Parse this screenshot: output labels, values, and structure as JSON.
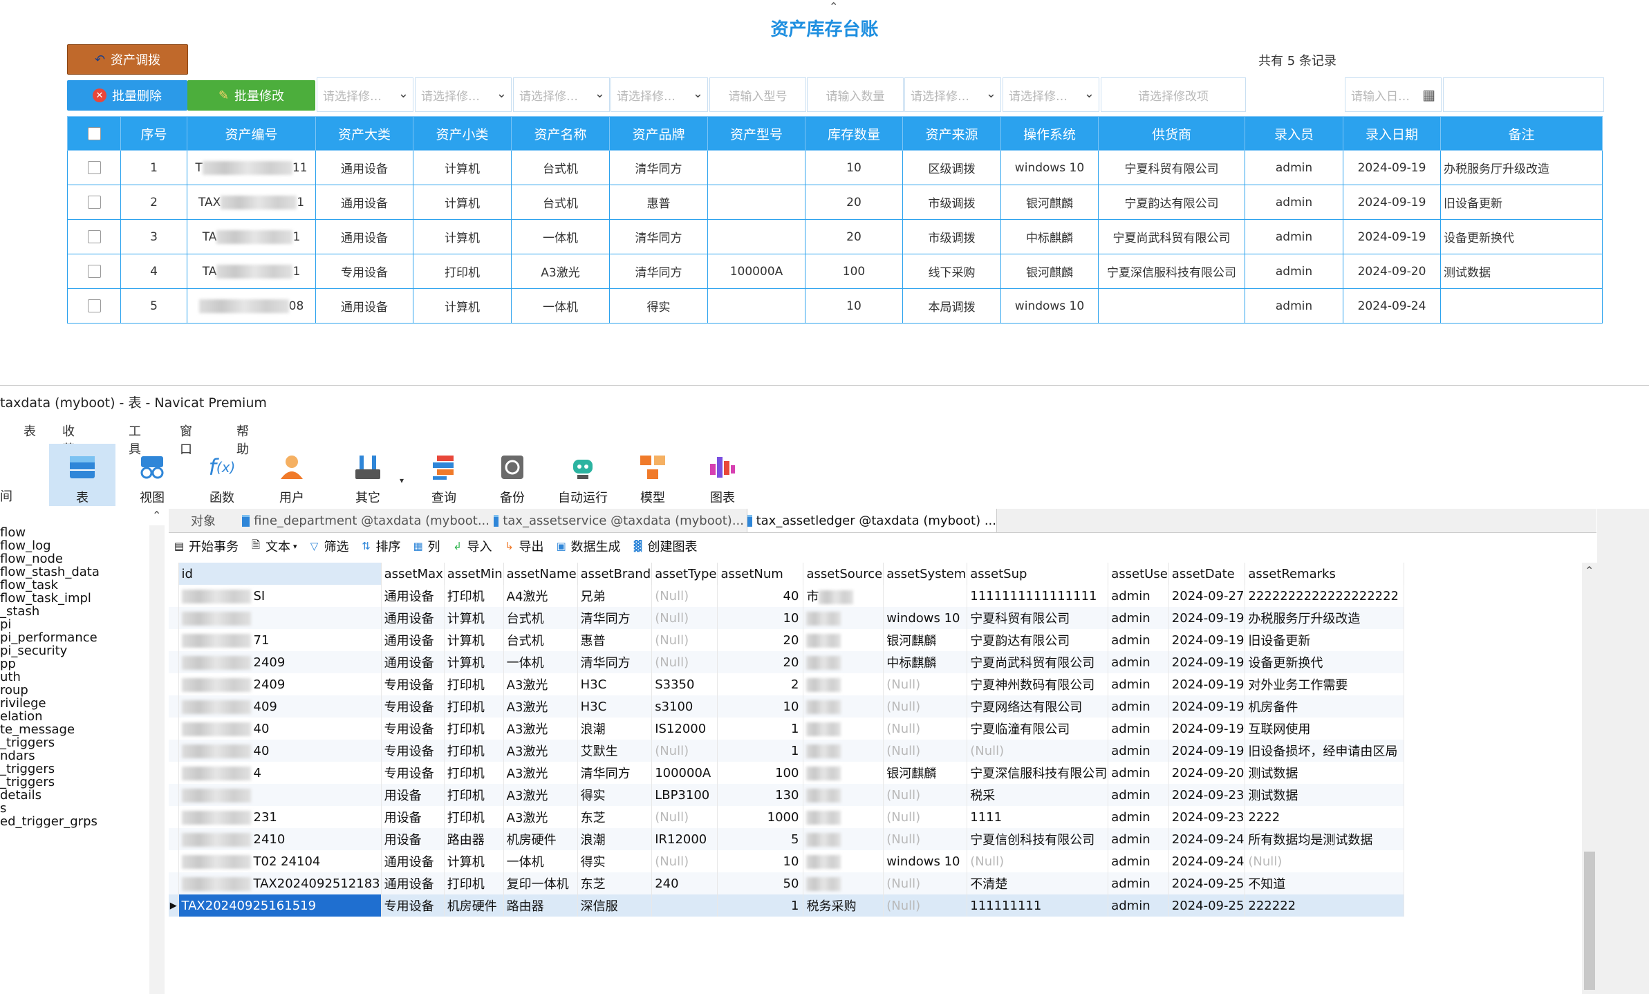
{
  "web": {
    "title": "资产库存台账",
    "collapse_icon": "double-chevron-up",
    "adjust_button": "资产调拨",
    "batch_delete_button": "批量删除",
    "batch_edit_button": "批量修改",
    "record_count": "共有 5 条记录",
    "filters": {
      "select_placeholder": "请选择修…",
      "model_placeholder": "请输入型号",
      "qty_placeholder": "请输入数量",
      "edit_item_placeholder": "请选择修改项",
      "date_placeholder": "请输入日…"
    },
    "columns": [
      "序号",
      "资产编号",
      "资产大类",
      "资产小类",
      "资产名称",
      "资产品牌",
      "资产型号",
      "库存数量",
      "资产来源",
      "操作系统",
      "供货商",
      "录入员",
      "录入日期",
      "备注"
    ],
    "rows": [
      {
        "no": "1",
        "code_prefix": "T",
        "code_suffix": "11",
        "major": "通用设备",
        "minor": "计算机",
        "name": "台式机",
        "brand": "清华同方",
        "model": "",
        "qty": "10",
        "source": "区级调拨",
        "os": "windows 10",
        "supplier": "宁夏科贸有限公司",
        "user": "admin",
        "date": "2024-09-19",
        "remark": "办税服务厅升级改造"
      },
      {
        "no": "2",
        "code_prefix": "TAX",
        "code_suffix": "1",
        "major": "通用设备",
        "minor": "计算机",
        "name": "台式机",
        "brand": "惠普",
        "model": "",
        "qty": "20",
        "source": "市级调拨",
        "os": "银河麒麟",
        "supplier": "宁夏韵达有限公司",
        "user": "admin",
        "date": "2024-09-19",
        "remark": "旧设备更新"
      },
      {
        "no": "3",
        "code_prefix": "TA",
        "code_suffix": "1",
        "major": "通用设备",
        "minor": "计算机",
        "name": "一体机",
        "brand": "清华同方",
        "model": "",
        "qty": "20",
        "source": "市级调拨",
        "os": "中标麒麟",
        "supplier": "宁夏尚武科贸有限公司",
        "user": "admin",
        "date": "2024-09-19",
        "remark": "设备更新换代"
      },
      {
        "no": "4",
        "code_prefix": "TA",
        "code_suffix": "1",
        "major": "专用设备",
        "minor": "打印机",
        "name": "A3激光",
        "brand": "清华同方",
        "model": "100000A",
        "qty": "100",
        "source": "线下采购",
        "os": "银河麒麟",
        "supplier": "宁夏深信服科技有限公司",
        "user": "admin",
        "date": "2024-09-20",
        "remark": "测试数据"
      },
      {
        "no": "5",
        "code_prefix": "",
        "code_suffix": "08",
        "major": "通用设备",
        "minor": "计算机",
        "name": "一体机",
        "brand": "得实",
        "model": "",
        "qty": "10",
        "source": "本局调拨",
        "os": "windows 10",
        "supplier": "",
        "user": "admin",
        "date": "2024-09-24",
        "remark": ""
      }
    ]
  },
  "navicat": {
    "window_title": "taxdata (myboot) - 表 - Navicat Premium",
    "menu": [
      "表",
      "收藏夹",
      "工具",
      "窗口",
      "帮助"
    ],
    "tools": [
      {
        "label": "表",
        "icon": "table-icon"
      },
      {
        "label": "视图",
        "icon": "view-icon"
      },
      {
        "label": "函数",
        "icon": "function-icon"
      },
      {
        "label": "用户",
        "icon": "user-icon"
      },
      {
        "label": "其它",
        "icon": "tools-icon"
      },
      {
        "label": "查询",
        "icon": "query-icon"
      },
      {
        "label": "备份",
        "icon": "backup-icon"
      },
      {
        "label": "自动运行",
        "icon": "robot-icon"
      },
      {
        "label": "模型",
        "icon": "model-icon"
      },
      {
        "label": "图表",
        "icon": "chart-icon"
      }
    ],
    "left_edge_label": "间",
    "sidebar": [
      "flow",
      "flow_log",
      "flow_node",
      "flow_stash_data",
      "flow_task",
      "flow_task_impl",
      "_stash",
      "pi",
      "pi_performance",
      "pi_security",
      "pp",
      "uth",
      "roup",
      "rivilege",
      "elation",
      "te_message",
      "_triggers",
      "ndars",
      "_triggers",
      "_triggers",
      "details",
      "s",
      "ed_trigger_grps"
    ],
    "tabs": [
      "对象",
      "fine_department @taxdata (myboot...",
      "tax_assetservice @taxdata (myboot)...",
      "tax_assetledger @taxdata (myboot) ..."
    ],
    "subtoolbar": [
      "开始事务",
      "文本",
      "筛选",
      "排序",
      "列",
      "导入",
      "导出",
      "数据生成",
      "创建图表"
    ],
    "grid_columns": [
      "id",
      "assetMax",
      "assetMin",
      "assetName",
      "assetBrand",
      "assetType",
      "assetNum",
      "assetSource",
      "assetSystem",
      "assetSup",
      "assetUse",
      "assetDate",
      "assetRemarks"
    ],
    "grid_rows": [
      {
        "id": "SI",
        "max": "通用设备",
        "min": "打印机",
        "name": "A4激光",
        "brand": "兄弟",
        "type": "(Null)",
        "num": "40",
        "src": "市",
        "sys": "",
        "sup": "1111111111111111",
        "use": "admin",
        "date": "2024-09-27",
        "remarks": "2222222222222222222"
      },
      {
        "id": "",
        "max": "通用设备",
        "min": "计算机",
        "name": "台式机",
        "brand": "清华同方",
        "type": "(Null)",
        "num": "10",
        "src": "",
        "sys": "windows 10",
        "sup": "宁夏科贸有限公司",
        "use": "admin",
        "date": "2024-09-19",
        "remarks": "办税服务厅升级改造"
      },
      {
        "id": "71",
        "max": "通用设备",
        "min": "计算机",
        "name": "台式机",
        "brand": "惠普",
        "type": "(Null)",
        "num": "20",
        "src": "",
        "sys": "银河麒麟",
        "sup": "宁夏韵达有限公司",
        "use": "admin",
        "date": "2024-09-19",
        "remarks": "旧设备更新"
      },
      {
        "id": "2409",
        "max": "通用设备",
        "min": "计算机",
        "name": "一体机",
        "brand": "清华同方",
        "type": "(Null)",
        "num": "20",
        "src": "",
        "sys": "中标麒麟",
        "sup": "宁夏尚武科贸有限公司",
        "use": "admin",
        "date": "2024-09-19",
        "remarks": "设备更新换代"
      },
      {
        "id": "2409",
        "max": "专用设备",
        "min": "打印机",
        "name": "A3激光",
        "brand": "H3C",
        "type": "S3350",
        "num": "2",
        "src": "",
        "sys": "(Null)",
        "sup": "宁夏神州数码有限公司",
        "use": "admin",
        "date": "2024-09-19",
        "remarks": "对外业务工作需要"
      },
      {
        "id": "409",
        "max": "专用设备",
        "min": "打印机",
        "name": "A3激光",
        "brand": "H3C",
        "type": "s3100",
        "num": "10",
        "src": "",
        "sys": "(Null)",
        "sup": "宁夏网络达有限公司",
        "use": "admin",
        "date": "2024-09-19",
        "remarks": "机房备件"
      },
      {
        "id": "40",
        "max": "专用设备",
        "min": "打印机",
        "name": "A3激光",
        "brand": "浪潮",
        "type": "IS12000",
        "num": "1",
        "src": "",
        "sys": "(Null)",
        "sup": "宁夏临潼有限公司",
        "use": "admin",
        "date": "2024-09-19",
        "remarks": "互联网使用"
      },
      {
        "id": "40",
        "max": "专用设备",
        "min": "打印机",
        "name": "A3激光",
        "brand": "艾默生",
        "type": "(Null)",
        "num": "1",
        "src": "",
        "sys": "(Null)",
        "sup": "(Null)",
        "use": "admin",
        "date": "2024-09-19",
        "remarks": "旧设备损坏，经申请由区局"
      },
      {
        "id": "4",
        "max": "专用设备",
        "min": "打印机",
        "name": "A3激光",
        "brand": "清华同方",
        "type": "100000A",
        "num": "100",
        "src": "",
        "sys": "银河麒麟",
        "sup": "宁夏深信服科技有限公司",
        "use": "admin",
        "date": "2024-09-20",
        "remarks": "测试数据"
      },
      {
        "id": "",
        "max": "用设备",
        "min": "打印机",
        "name": "A3激光",
        "brand": "得实",
        "type": "LBP3100",
        "num": "130",
        "src": "",
        "sys": "(Null)",
        "sup": "税采",
        "use": "admin",
        "date": "2024-09-23",
        "remarks": "测试数据"
      },
      {
        "id": "231",
        "max": "用设备",
        "min": "打印机",
        "name": "A3激光",
        "brand": "东芝",
        "type": "(Null)",
        "num": "1000",
        "src": "",
        "sys": "(Null)",
        "sup": "1111",
        "use": "admin",
        "date": "2024-09-23",
        "remarks": "2222"
      },
      {
        "id": "2410",
        "max": "用设备",
        "min": "路由器",
        "name": "机房硬件",
        "brand": "浪潮",
        "type": "IR12000",
        "num": "5",
        "src": "",
        "sys": "(Null)",
        "sup": "宁夏信创科技有限公司",
        "use": "admin",
        "date": "2024-09-24",
        "remarks": "所有数据均是测试数据"
      },
      {
        "id": "T02 24104",
        "max": "通用设备",
        "min": "计算机",
        "name": "一体机",
        "brand": "得实",
        "type": "(Null)",
        "num": "10",
        "src": "",
        "sys": "windows 10",
        "sup": "(Null)",
        "use": "admin",
        "date": "2024-09-24",
        "remarks": "(Null)"
      },
      {
        "id": "TAX2024092512183",
        "max": "通用设备",
        "min": "打印机",
        "name": "复印一体机",
        "brand": "东芝",
        "type": "240",
        "num": "50",
        "src": "",
        "sys": "(Null)",
        "sup": "不清楚",
        "use": "admin",
        "date": "2024-09-25",
        "remarks": "不知道"
      },
      {
        "id": "TAX20240925161519",
        "max": "专用设备",
        "min": "机房硬件",
        "name": "路由器",
        "brand": "深信服",
        "type": "",
        "num": "1",
        "src": "税务采购",
        "sys": "(Null)",
        "sup": "111111111",
        "use": "admin",
        "date": "2024-09-25",
        "remarks": "222222"
      }
    ]
  }
}
